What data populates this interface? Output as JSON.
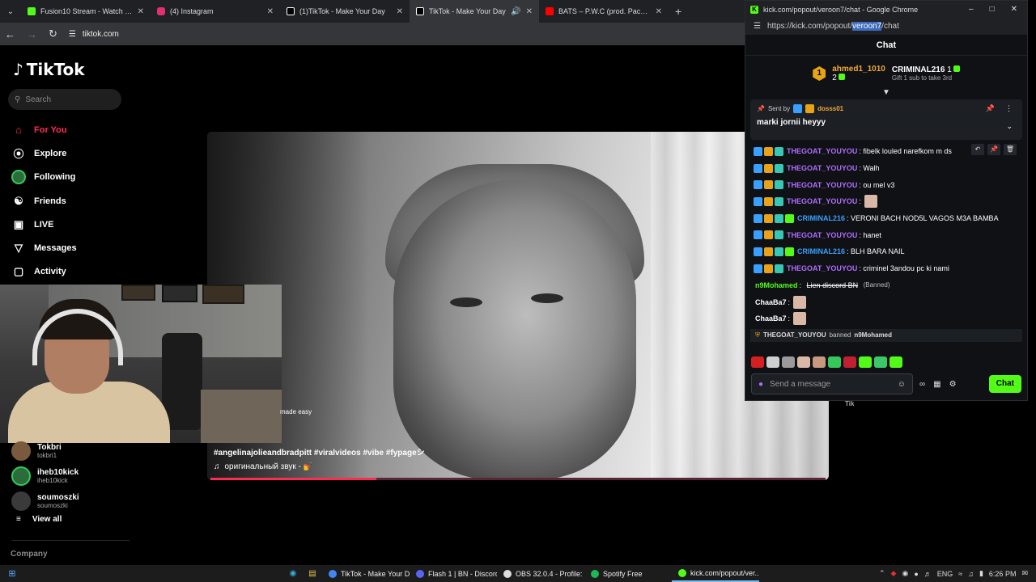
{
  "browser": {
    "tabs": [
      {
        "label": "Fusion10 Stream - Watch Live o",
        "color": "#53fc18"
      },
      {
        "label": "(4) Instagram",
        "color": "#e1306c"
      },
      {
        "label": "(1)TikTok - Make Your Day",
        "color": "#ffffff"
      },
      {
        "label": "TikTok - Make Your Day",
        "color": "#ffffff"
      },
      {
        "label": "BATS – P.W.C (prod. Pache Beat",
        "color": "#ff0000"
      }
    ],
    "url": "tiktok.com"
  },
  "tiktok": {
    "logo": "TikTok",
    "search_placeholder": "Search",
    "nav": [
      {
        "label": "For You",
        "icon": "home-icon"
      },
      {
        "label": "Explore",
        "icon": "compass-icon"
      },
      {
        "label": "Following",
        "icon": "following-avatar"
      },
      {
        "label": "Friends",
        "icon": "friends-icon"
      },
      {
        "label": "LIVE",
        "icon": "live-icon"
      },
      {
        "label": "Messages",
        "icon": "messages-icon"
      },
      {
        "label": "Activity",
        "icon": "activity-icon"
      }
    ],
    "caption_fragment": "made easy",
    "hashtags": "#angelinajolieandbradpitt #viralvideos #vibe #fypageシ",
    "sound": "оригинальный звук - 💅",
    "progress": 0.27,
    "accounts": [
      {
        "name": "Tokbri",
        "user": "tokbri1",
        "color": "#7a5a3c"
      },
      {
        "name": "iheb10kick",
        "user": "iheb10kick",
        "color": "#2b6d3a"
      },
      {
        "name": "soumoszki",
        "user": "soumoszki",
        "color": "#3a3a3a"
      }
    ],
    "view_all": "View all",
    "company": "Company",
    "right_fragment": "Tik"
  },
  "kick": {
    "window_title": "kick.com/popout/veroon7/chat - Google Chrome",
    "url_prefix": "https://kick.com/popout/",
    "url_selected": "veroon7",
    "url_suffix": "/chat",
    "chat_title": "Chat",
    "leaderboard": {
      "rank": "1",
      "first_user": "ahmed1_1010",
      "first_count": "2",
      "second_user": "CRIMINAL216",
      "second_count": "1",
      "gift_prompt": "Gift 1 sub to take 3rd"
    },
    "pinned": {
      "sent_by": "Sent by",
      "sender": "dosss01",
      "message": "marki jornii heyyy"
    },
    "messages": [
      {
        "user": "THEGOAT_YOUYOU",
        "color": "#b06cff",
        "text": ": fibelk louled narefkom m ds",
        "badges": [
          "blue",
          "gold",
          "teal"
        ]
      },
      {
        "user": "THEGOAT_YOUYOU",
        "color": "#b06cff",
        "text": ": Walh",
        "badges": [
          "blue",
          "gold",
          "teal"
        ]
      },
      {
        "user": "THEGOAT_YOUYOU",
        "color": "#b06cff",
        "text": ": ou mel v3",
        "badges": [
          "blue",
          "gold",
          "teal"
        ]
      },
      {
        "user": "THEGOAT_YOUYOU",
        "color": "#b06cff",
        "text": ":",
        "badges": [
          "blue",
          "gold",
          "teal"
        ],
        "emote": true
      },
      {
        "user": "CRIMINAL216",
        "color": "#3aa0ff",
        "text": ": VERONI BACH NOD5L VAGOS M3A BAMBA",
        "badges": [
          "blue",
          "gold",
          "teal",
          "green"
        ]
      },
      {
        "user": "THEGOAT_YOUYOU",
        "color": "#b06cff",
        "text": ": hanet",
        "badges": [
          "blue",
          "gold",
          "teal"
        ]
      },
      {
        "user": "CRIMINAL216",
        "color": "#3aa0ff",
        "text": ": BLH BARA NAIL",
        "badges": [
          "blue",
          "gold",
          "teal",
          "green"
        ]
      },
      {
        "user": "THEGOAT_YOUYOU",
        "color": "#b06cff",
        "text": ": criminel 3andou pc ki nami",
        "badges": [
          "blue",
          "gold",
          "teal"
        ]
      }
    ],
    "banned_msg": {
      "user": "n9Mohamed",
      "color": "#53fc18",
      "text": "Lien discord BN",
      "note": "(Banned)"
    },
    "emote_msgs": [
      {
        "user": "ChaaBa7",
        "color": "#ffffff"
      },
      {
        "user": "ChaaBa7",
        "color": "#ffffff"
      }
    ],
    "ban_notice": {
      "mod": "THEGOAT_YOUYOU",
      "action": "banned",
      "target": "n9Mohamed"
    },
    "input_placeholder": "Send a message",
    "send_label": "Chat"
  },
  "taskbar": {
    "tasks": [
      {
        "label": "TikTok - Make Your D...",
        "color": "#4285f4"
      },
      {
        "label": "Flash 1 | BN - Discord",
        "color": "#5865f2"
      },
      {
        "label": "OBS 32.0.4 - Profile: U...",
        "color": "#dddddd"
      },
      {
        "label": "Spotify Free",
        "color": "#1db954"
      },
      {
        "label": "kick.com/popout/ver...",
        "color": "#53fc18"
      }
    ],
    "lang": "ENG",
    "time": "6:26 PM"
  }
}
